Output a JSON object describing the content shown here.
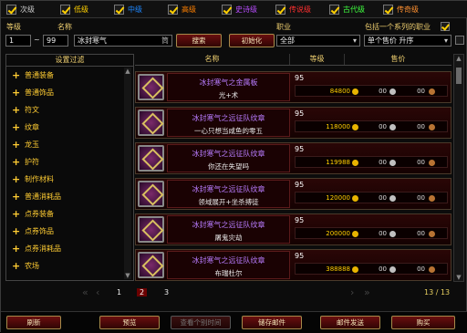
{
  "quality_filters": [
    {
      "label": "次级",
      "color": "#9d9d9d"
    },
    {
      "label": "低级",
      "color": "#ffd000"
    },
    {
      "label": "中级",
      "color": "#1e88ff"
    },
    {
      "label": "高级",
      "color": "#ff8000"
    },
    {
      "label": "史诗级",
      "color": "#b94dff"
    },
    {
      "label": "传说级",
      "color": "#ff3030"
    },
    {
      "label": "古代级",
      "color": "#40ff40"
    },
    {
      "label": "传奇级",
      "color": "#ff9030"
    }
  ],
  "filter_labels": {
    "level": "等级",
    "name": "名称",
    "profession": "职业",
    "include_series": "包括一个系列的职业"
  },
  "filter": {
    "level_min": "1",
    "level_sep": "~",
    "level_max": "99",
    "name_value": "冰封寒气",
    "name_suffix": "筒",
    "search_button": "搜索",
    "reset_button": "初始化",
    "profession_value": "全部",
    "sort_value": "单个售价 升序"
  },
  "left_panel": {
    "header": "设置过滤",
    "categories": [
      "普通装备",
      "普通饰品",
      "符文",
      "纹章",
      "龙玉",
      "护符",
      "制作材料",
      "普通消耗品",
      "点券装备",
      "点券饰品",
      "点券消耗品",
      "农场"
    ]
  },
  "table": {
    "columns": [
      "名称",
      "等级",
      "售价"
    ],
    "rows": [
      {
        "name": "冰封寒气之金属板",
        "sub": "光+术",
        "level": "95",
        "gold": "84800",
        "silver": "00",
        "copper": "00"
      },
      {
        "name": "冰封寒气之远征队纹章",
        "sub": "一心只想当咸鱼的零五",
        "level": "95",
        "gold": "118000",
        "silver": "00",
        "copper": "00"
      },
      {
        "name": "冰封寒气之远征队纹章",
        "sub": "你还在失望吗",
        "level": "95",
        "gold": "119988",
        "silver": "00",
        "copper": "00"
      },
      {
        "name": "冰封寒气之远征队纹章",
        "sub": "领域展开+坐杀搏徒",
        "level": "95",
        "gold": "120000",
        "silver": "00",
        "copper": "00"
      },
      {
        "name": "冰封寒气之远征队纹章",
        "sub": "屠鬼灾劫",
        "level": "95",
        "gold": "200000",
        "silver": "00",
        "copper": "00"
      },
      {
        "name": "冰封寒气之远征队纹章",
        "sub": "布瑞杜尔",
        "level": "95",
        "gold": "388888",
        "silver": "00",
        "copper": "00"
      }
    ]
  },
  "pager": {
    "pages": [
      "1",
      "2",
      "3"
    ],
    "current": "2",
    "count": "13 / 13"
  },
  "bottom_buttons": [
    "刷新",
    "预览",
    "查看个别时间",
    "储存邮件",
    "邮件发送",
    "购买"
  ]
}
